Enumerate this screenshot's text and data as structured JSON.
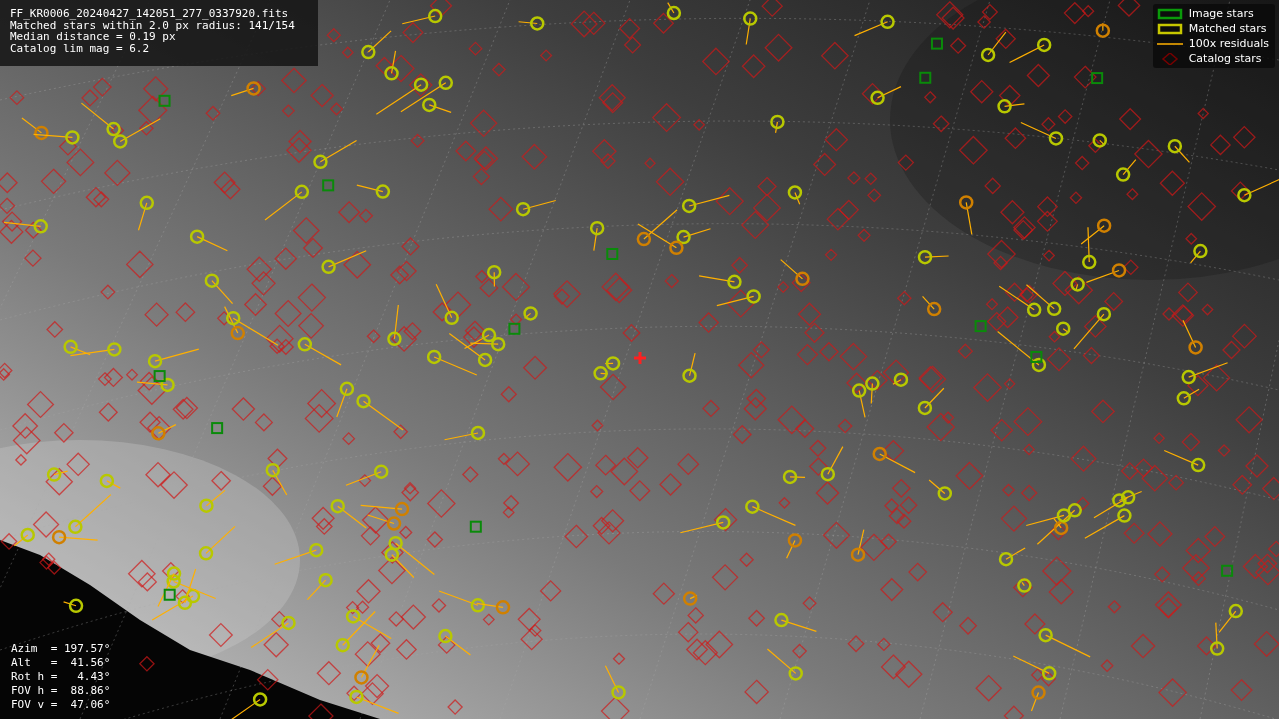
{
  "info": {
    "lines": [
      "FF_KR0006_20240427_142051_277_0337920.fits",
      "Matched stars within 2.0 px radius: 141/154",
      "Median distance = 0.19 px",
      "Catalog lim mag = 6.2"
    ]
  },
  "legend": [
    {
      "label": "Image stars",
      "kind": "image"
    },
    {
      "label": "Matched stars",
      "kind": "matched"
    },
    {
      "label": "100x residuals",
      "kind": "residual"
    },
    {
      "label": "Catalog stars",
      "kind": "catalog"
    }
  ],
  "pointing": {
    "lines": [
      "Azim  = 197.57°",
      "Alt   =  41.56°",
      "Rot h =   4.43°",
      "FOV h =  88.86°",
      "FOV v =  47.06°"
    ]
  }
}
